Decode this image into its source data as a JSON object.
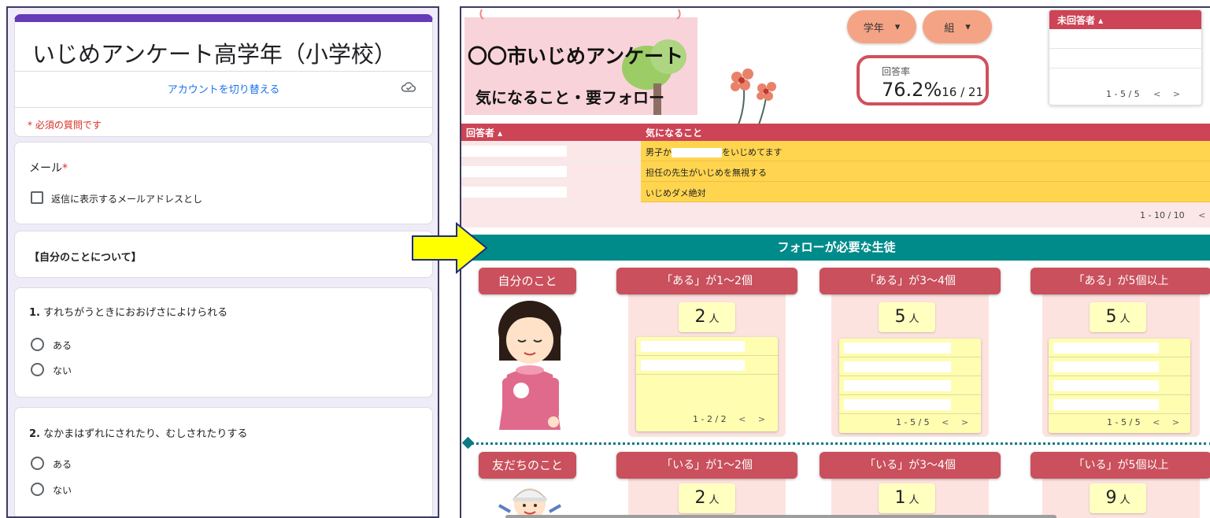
{
  "form": {
    "title": "いじめアンケート高学年（小学校）",
    "switch_account": "アカウントを切り替える",
    "required_note": "* 必須の質問です",
    "email_label": "メール",
    "required_mark": "*",
    "email_checkbox_label": "返信に表示するメールアドレスとし",
    "section_title": "【自分のことについて】",
    "questions": [
      {
        "num": "1.",
        "text": "すれちがうときにおおげさによけられる",
        "options": [
          "ある",
          "ない"
        ]
      },
      {
        "num": "2.",
        "text": "なかまはずれにされたり、むしされたりする",
        "options": [
          "ある",
          "ない"
        ]
      }
    ]
  },
  "dashboard": {
    "banner_line1": "〇〇市いじめアンケート",
    "banner_line2": "気になること・要フォロー",
    "filter_grade": "学年",
    "filter_class": "組",
    "dropdown_caret": "▾",
    "response_rate_label": "回答率",
    "response_rate_value": "76.2%",
    "response_count": "16 / 21",
    "non_respondents_header": "未回答者 ▴",
    "non_respondents_pager": "1 - 5 / 5",
    "table_header_respondent": "回答者 ▴",
    "table_header_concern": "気になること",
    "table_rows": [
      {
        "concern_before": "男子か",
        "concern_after": "をいじめてます"
      },
      {
        "concern_before": "担任の先生がいじめを無視する",
        "concern_after": ""
      },
      {
        "concern_before": "いじめダメ絶対",
        "concern_after": ""
      }
    ],
    "table_pager": "1 - 10 / 10",
    "follow_title": "フォローが必要な生徒",
    "unit": "人",
    "nav_prev": "<",
    "nav_next": ">",
    "categories": [
      {
        "label": "自分のこと",
        "groups": [
          {
            "header": "「ある」が1〜2個",
            "count": "2",
            "pager": "1 - 2 / 2"
          },
          {
            "header": "「ある」が3〜4個",
            "count": "5",
            "pager": "1 - 5 / 5"
          },
          {
            "header": "「ある」が5個以上",
            "count": "5",
            "pager": "1 - 5 / 5"
          }
        ]
      },
      {
        "label": "友だちのこと",
        "groups": [
          {
            "header": "「いる」が1〜2個",
            "count": "2"
          },
          {
            "header": "「いる」が3〜4個",
            "count": "1"
          },
          {
            "header": "「いる」が5個以上",
            "count": "9"
          }
        ]
      }
    ]
  },
  "colors": {
    "form_accent": "#673ab7",
    "required_red": "#d93025",
    "link_blue": "#1a73e8",
    "dashboard_red": "#cc4455",
    "teal": "#008b8b",
    "highlight_yellow": "#ffd54f",
    "arrow_yellow": "#ffff00"
  },
  "icons": [
    "cloud-save-icon",
    "checkbox-icon",
    "radio-icon",
    "arrow-right-icon",
    "sort-up-icon",
    "chevron-left-icon",
    "chevron-right-icon",
    "diamond-icon"
  ]
}
